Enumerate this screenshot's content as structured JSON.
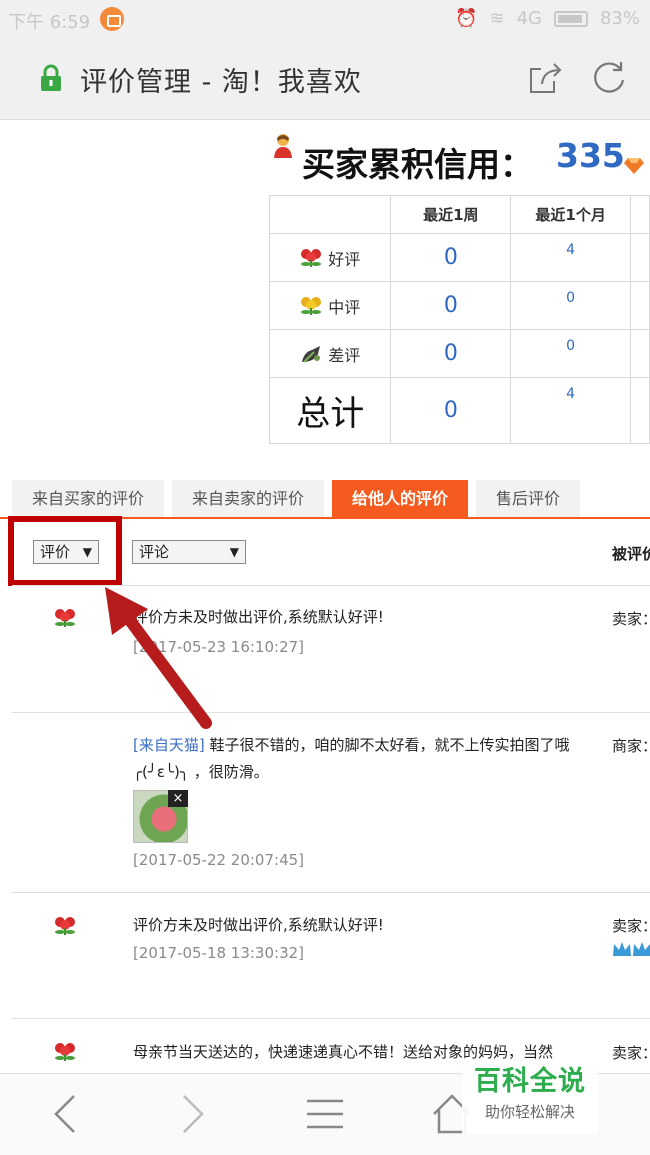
{
  "status_bar": {
    "time": "下午 6:59",
    "network": "4G",
    "battery": "83%"
  },
  "title_bar": {
    "title": "评价管理 - 淘！我喜欢"
  },
  "credit": {
    "label": "买家累积信用：",
    "score": "335"
  },
  "rating_table": {
    "headers": [
      "",
      "最近1周",
      "最近1个月"
    ],
    "rows": [
      {
        "label": "好评",
        "icon": "red-flower-icon",
        "week": "0",
        "month": "4"
      },
      {
        "label": "中评",
        "icon": "yellow-flower-icon",
        "week": "0",
        "month": "0"
      },
      {
        "label": "差评",
        "icon": "bad-rating-icon",
        "week": "0",
        "month": "0"
      },
      {
        "label": "总计",
        "icon": "",
        "week": "0",
        "month": "4"
      }
    ]
  },
  "tabs": [
    {
      "label": "来自买家的评价",
      "active": false
    },
    {
      "label": "来自卖家的评价",
      "active": false
    },
    {
      "label": "给他人的评价",
      "active": true
    },
    {
      "label": "售后评价",
      "active": false
    }
  ],
  "filters": {
    "rating_select": "评价",
    "comment_select": "评论",
    "column_header": "被评价"
  },
  "reviews": [
    {
      "icon": "red-flower-icon",
      "source": "",
      "text": "评价方未及时做出评价,系统默认好评!",
      "date": "[2017-05-23 16:10:27]",
      "role": "卖家："
    },
    {
      "icon": "",
      "source": "[来自天猫]",
      "text": " 鞋子很不错的，咱的脚不太好看，就不上传实拍图了哦 ╭(╯ε╰)╮ ，很防滑。",
      "date": "[2017-05-22 20:07:45]",
      "role": "商家："
    },
    {
      "icon": "red-flower-icon",
      "source": "",
      "text": "评价方未及时做出评价,系统默认好评!",
      "date": "[2017-05-18 13:30:32]",
      "role": "卖家："
    },
    {
      "icon": "red-flower-icon",
      "source": "",
      "text": "母亲节当天送达的，快递速递真心不错！送给对象的妈妈，当然",
      "date": "",
      "role": "卖家："
    }
  ],
  "photo_close": "×",
  "watermark": {
    "title": "百科全说",
    "subtitle": "助你轻松解决"
  },
  "colors": {
    "accent_orange": "#f55a1e",
    "link_blue": "#2f69c2",
    "annotation_red": "#c00000",
    "watermark_green": "#2dad4d"
  }
}
